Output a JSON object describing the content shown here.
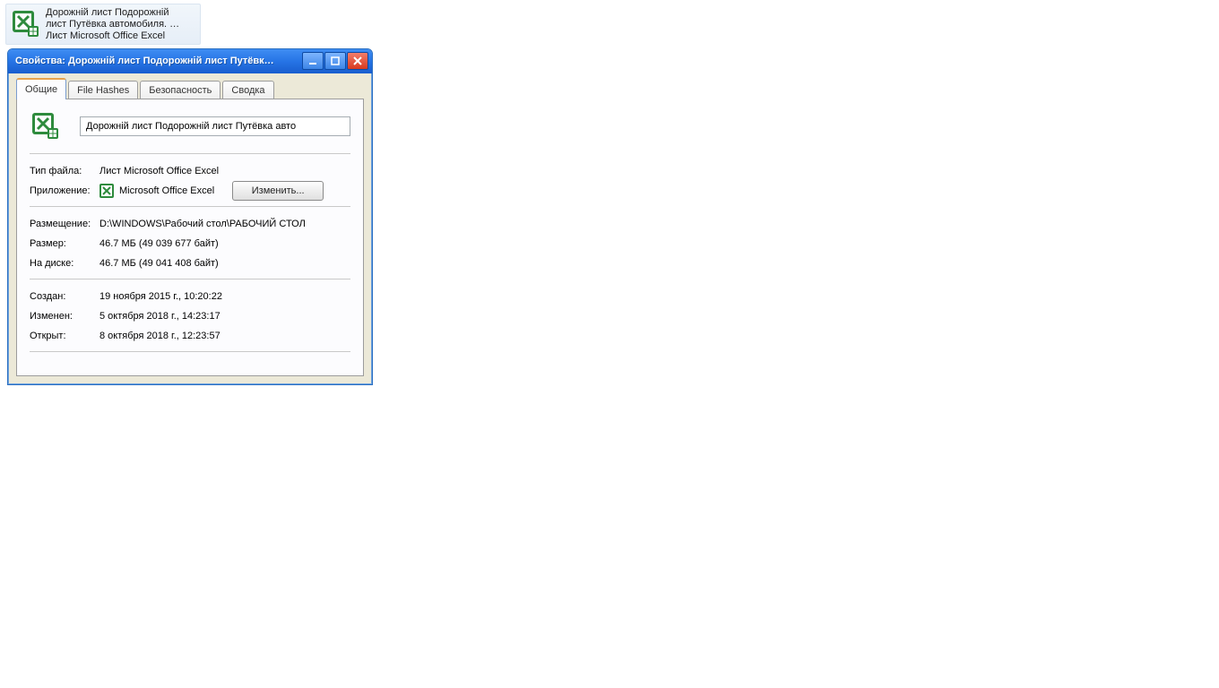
{
  "desktop": {
    "icon_name": "excel-file",
    "label_line1": "Дорожній лист Подорожній",
    "label_line2": "лист Путёвка автомобиля. …",
    "label_line3": "Лист Microsoft Office Excel"
  },
  "window": {
    "title": "Свойства: Дорожній лист Подорожній лист Путёвк…",
    "tabs": {
      "general": "Общие",
      "hashes": "File Hashes",
      "security": "Безопасность",
      "summary": "Сводка"
    },
    "filename": "Дорожній лист Подорожній лист Путёвка авто",
    "labels": {
      "filetype": "Тип файла:",
      "app": "Приложение:",
      "change": "Изменить...",
      "location": "Размещение:",
      "size": "Размер:",
      "size_on_disk": "На диске:",
      "created": "Создан:",
      "modified": "Изменен:",
      "accessed": "Открыт:"
    },
    "values": {
      "filetype": "Лист Microsoft Office Excel",
      "app": "Microsoft Office Excel",
      "location": "D:\\WINDOWS\\Рабочий стол\\РАБОЧИЙ СТОЛ",
      "size": "46.7 МБ (49 039 677 байт)",
      "size_on_disk": "46.7 МБ (49 041 408 байт)",
      "created": "19 ноября 2015 г., 10:20:22",
      "modified": "5 октября 2018 г., 14:23:17",
      "accessed": "8 октября 2018 г., 12:23:57"
    }
  }
}
